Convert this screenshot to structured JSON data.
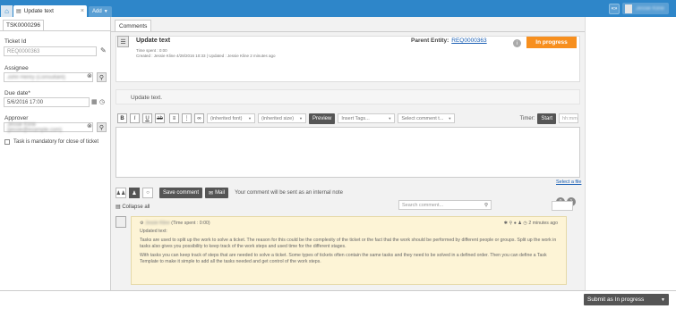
{
  "header": {
    "tab_title": "Update text",
    "add_label": "Add",
    "user_name": "Jessie Kline"
  },
  "left": {
    "tab_label": "TSK0000296",
    "ticket_id_label": "Ticket Id",
    "ticket_id_value": "REQ0000363",
    "assignee_label": "Assignee",
    "assignee_value": "John Henry (Consultant)",
    "due_label": "Due date*",
    "due_value": "5/6/2016 17:00",
    "approver_label": "Approver",
    "approver_value": "Jessie Kline (jessie@example.com)",
    "mandatory_label": "Task is mandatory for close of ticket"
  },
  "main": {
    "tab_label": "Comments",
    "title": "Update text",
    "time_spent": "Time spent : 0:00",
    "created": "Created : Jessie Kline 4/28/2016 10:33 | Updated : Jessie Kline 2 minutes ago",
    "parent_label": "Parent Entity:",
    "parent_link": "REQ0000363",
    "status": "In progress",
    "body_preview": "Update text.",
    "font_select": "(inherited font)",
    "size_select": "(inherited size)",
    "preview_label": "Preview",
    "insert_tags": "Insert Tags...",
    "select_comment": "Select comment t...",
    "timer_label": "Timer:",
    "start_label": "Start",
    "hhmm_placeholder": "hh:mm",
    "attach_link": "Select a file",
    "save_comment": "Save comment",
    "mail_label": "Mail",
    "internal_note": "Your comment will be sent as an internal note",
    "collapse_all": "Collapse all",
    "search_placeholder": "Search comment...",
    "badge_count_1": "0",
    "badge_count_2": "1"
  },
  "comment": {
    "author": "Jessie Kline",
    "time_spent": "(Time spent : 0:00)",
    "time_ago": "2 minutes ago",
    "heading": "Updated text:",
    "para1": "Tasks are used to split up the work to solve a ticket. The reason for this could be the complexity of the ticket or the fact that the work should be performed by different people or groups. Split up the work in tasks also gives you possibility to keep track of the work steps and used time for the different stages.",
    "para2": "With tasks you can keep track of steps that are needed to solve a ticket. Some types of tickets often contain the same tasks and they need to be solved in a defined order. Then you can define a Task Template to make it simple to add all the tasks needed and get control of the work steps."
  },
  "footer": {
    "submit_label": "Submit as In progress"
  },
  "colors": {
    "topbar": "#2e86c9",
    "status": "#f78f1e",
    "comment_bg": "#fdf4d6"
  }
}
